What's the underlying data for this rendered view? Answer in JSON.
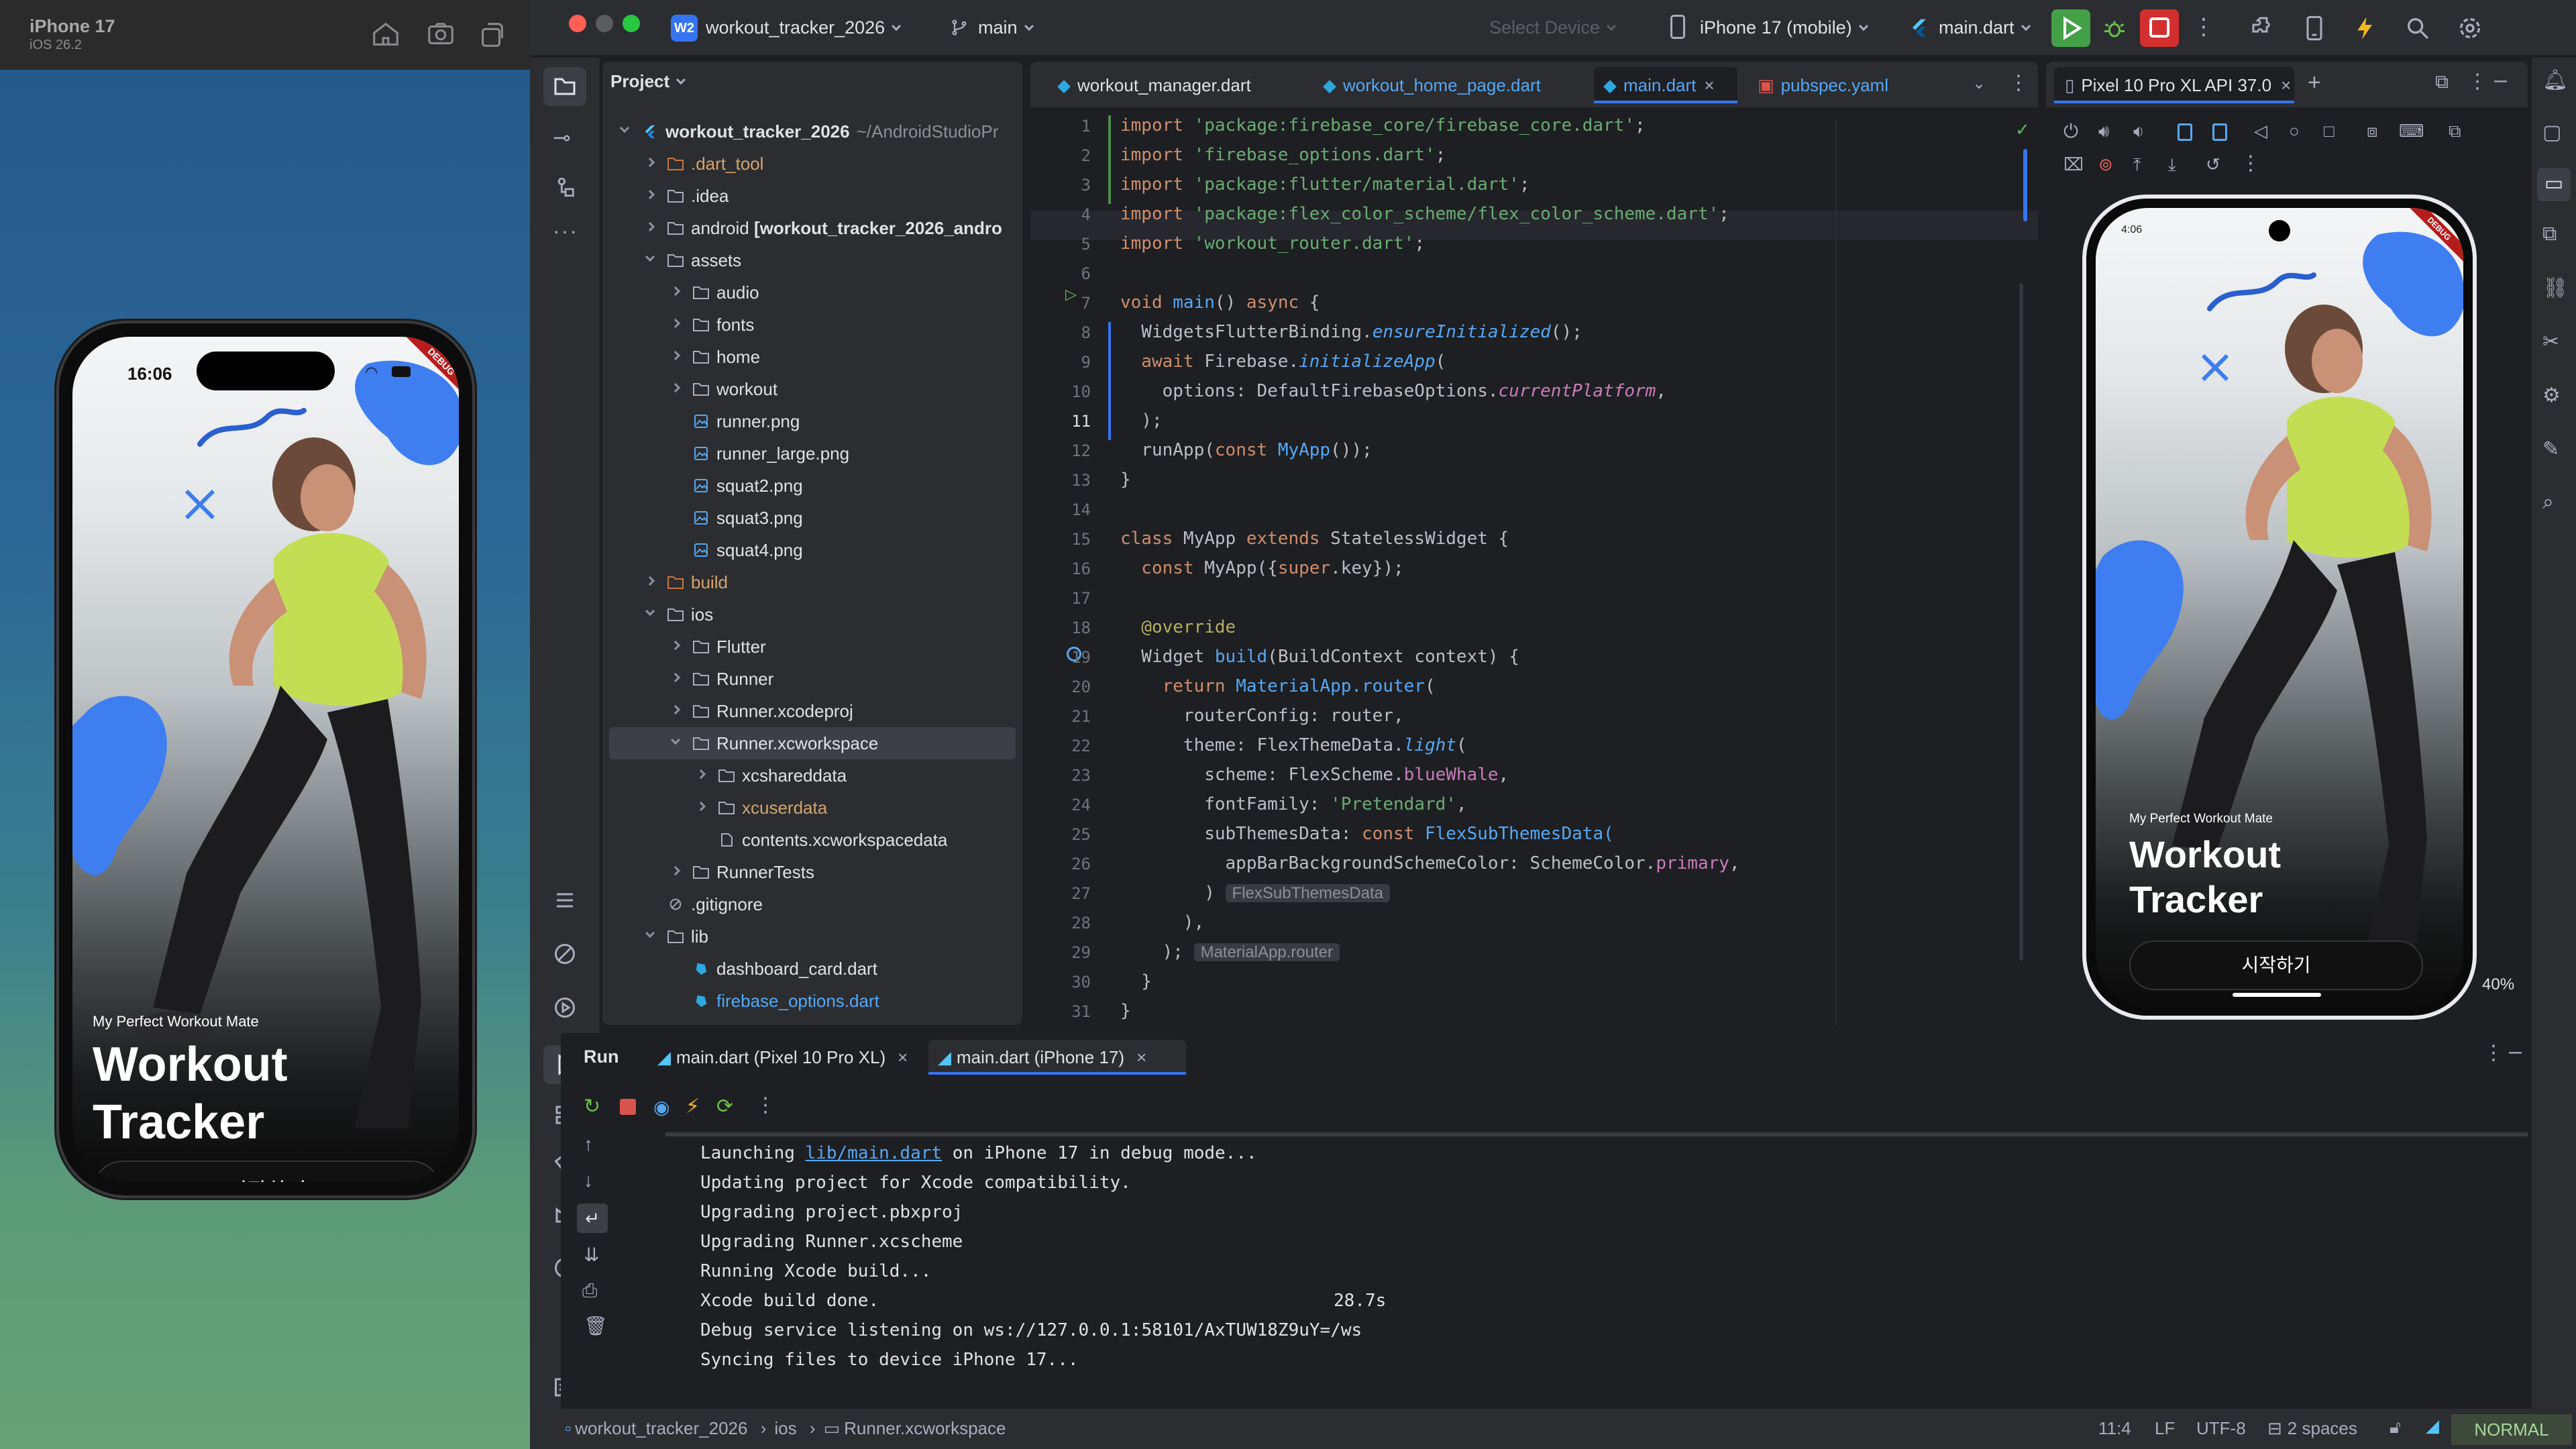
{
  "simulator": {
    "device_name": "iPhone 17",
    "os_version": "iOS 26.2",
    "time": "16:06",
    "app": {
      "subtitle": "My Perfect Workout Mate",
      "title": "Workout Tracker",
      "start_button": "시작하기",
      "debug_badge": "DEBUG"
    }
  },
  "toolbar": {
    "project_badge": "W2",
    "project_name": "workout_tracker_2026",
    "branch": "main",
    "select_device": "Select Device",
    "device": "iPhone 17 (mobile)",
    "run_config": "main.dart"
  },
  "project_panel": {
    "header": "Project",
    "root_name": "workout_tracker_2026",
    "root_path": "~/AndroidStudioPr",
    "items": [
      {
        "label": "workout_tracker_2026",
        "type": "root"
      },
      {
        "label": ".dart_tool",
        "type": "folder-excluded"
      },
      {
        "label": ".idea",
        "type": "folder"
      },
      {
        "label": "android",
        "suffix": "[workout_tracker_2026_andro",
        "type": "folder"
      },
      {
        "label": "assets",
        "type": "folder"
      },
      {
        "label": "audio",
        "type": "folder"
      },
      {
        "label": "fonts",
        "type": "folder"
      },
      {
        "label": "home",
        "type": "folder"
      },
      {
        "label": "workout",
        "type": "folder"
      },
      {
        "label": "runner.png",
        "type": "image"
      },
      {
        "label": "runner_large.png",
        "type": "image"
      },
      {
        "label": "squat2.png",
        "type": "image"
      },
      {
        "label": "squat3.png",
        "type": "image"
      },
      {
        "label": "squat4.png",
        "type": "image"
      },
      {
        "label": "build",
        "type": "folder-excluded"
      },
      {
        "label": "ios",
        "type": "folder"
      },
      {
        "label": "Flutter",
        "type": "folder"
      },
      {
        "label": "Runner",
        "type": "folder"
      },
      {
        "label": "Runner.xcodeproj",
        "type": "folder"
      },
      {
        "label": "Runner.xcworkspace",
        "type": "folder"
      },
      {
        "label": "xcshareddata",
        "type": "folder"
      },
      {
        "label": "xcuserdata",
        "type": "folder"
      },
      {
        "label": "contents.xcworkspacedata",
        "type": "file"
      },
      {
        "label": "RunnerTests",
        "type": "folder"
      },
      {
        "label": ".gitignore",
        "type": "ignore"
      },
      {
        "label": "lib",
        "type": "folder"
      },
      {
        "label": "dashboard_card.dart",
        "type": "dart"
      },
      {
        "label": "firebase_options.dart",
        "type": "dart"
      }
    ]
  },
  "editor": {
    "tabs": [
      {
        "label": "workout_manager.dart"
      },
      {
        "label": "workout_home_page.dart"
      },
      {
        "label": "main.dart"
      },
      {
        "label": "pubspec.yaml"
      }
    ],
    "line_numbers": [
      "1",
      "2",
      "3",
      "4",
      "5",
      "6",
      "7",
      "8",
      "9",
      "10",
      "11",
      "12",
      "13",
      "14",
      "15",
      "16",
      "17",
      "18",
      "19",
      "20",
      "21",
      "22",
      "23",
      "24",
      "25",
      "26",
      "27",
      "28",
      "29",
      "30",
      "31"
    ],
    "code": {
      "l1a": "import ",
      "l1b": "'package:firebase_core/firebase_core.dart'",
      "l1c": ";",
      "l2a": "import ",
      "l2b": "'firebase_options.dart'",
      "l2c": ";",
      "l3a": "import ",
      "l3b": "'package:flutter/material.dart'",
      "l3c": ";",
      "l4a": "import ",
      "l4b": "'package:flex_color_scheme/flex_color_scheme.dart'",
      "l4c": ";",
      "l5a": "import ",
      "l5b": "'workout_router.dart'",
      "l5c": ";",
      "l7a": "void ",
      "l7b": "main",
      "l7c": "() ",
      "l7d": "async ",
      "l7e": "{",
      "l8a": "  WidgetsFlutterBinding.",
      "l8b": "ensureInitialized",
      "l8c": "();",
      "l9a": "  await ",
      "l9b": "Firebase.",
      "l9c": "initializeApp",
      "l9d": "(",
      "l10a": "    options: DefaultFirebaseOptions.",
      "l10b": "currentPlatform",
      "l10c": ",",
      "l11a": "  );",
      "l12a": "  runApp(",
      "l12b": "const ",
      "l12c": "MyApp",
      "l12d": "());",
      "l13a": "}",
      "l15a": "class ",
      "l15b": "MyApp ",
      "l15c": "extends ",
      "l15d": "StatelessWidget {",
      "l16a": "  const ",
      "l16b": "MyApp({",
      "l16c": "super",
      "l16d": ".key});",
      "l18a": "  @override",
      "l19a": "  Widget ",
      "l19b": "build",
      "l19c": "(BuildContext context) {",
      "l20a": "    return ",
      "l20b": "MaterialApp.",
      "l20c": "router",
      "l20d": "(",
      "l21a": "      routerConfig: router,",
      "l22a": "      theme: FlexThemeData.",
      "l22b": "light",
      "l22c": "(",
      "l23a": "        scheme: FlexScheme.",
      "l23b": "blueWhale",
      "l23c": ",",
      "l24a": "        fontFamily: ",
      "l24b": "'Pretendard'",
      "l24c": ",",
      "l25a": "        subThemesData: ",
      "l25b": "const ",
      "l25c": "FlexSubThemesData(",
      "l26a": "          appBarBackgroundSchemeColor: SchemeColor.",
      "l26b": "primary",
      "l26c": ",",
      "l27a": "        )",
      "l27b": "FlexSubThemesData",
      "l28a": "      ),",
      "l29a": "    );",
      "l29b": "MaterialApp.router",
      "l30a": "  }",
      "l31a": "}"
    }
  },
  "device_panel": {
    "tab": "Pixel 10 Pro XL API 37.0",
    "time": "4:06",
    "zoom": "40%"
  },
  "run_panel": {
    "title": "Run",
    "tabs": [
      {
        "label": "main.dart (Pixel 10 Pro XL)"
      },
      {
        "label": "main.dart (iPhone 17)"
      }
    ],
    "console": {
      "l1a": "Launching ",
      "l1b": "lib/main.dart",
      "l1c": " on iPhone 17 in debug mode...",
      "l2": "Updating project for Xcode compatibility.",
      "l3": "Upgrading project.pbxproj",
      "l4": "Upgrading Runner.xcscheme",
      "l5": "Running Xcode build...",
      "l6a": "Xcode build done.",
      "l6b": "28.7s",
      "l7": "Debug service listening on ws://127.0.0.1:58101/AxTUW18Z9uY=/ws",
      "l8": "Syncing files to device iPhone 17..."
    }
  },
  "status_bar": {
    "crumbs": [
      "workout_tracker_2026",
      "ios",
      "Runner.xcworkspace"
    ],
    "position": "11:4",
    "line_sep": "LF",
    "encoding": "UTF-8",
    "indent": "2 spaces",
    "mode": "NORMAL"
  },
  "colors": {
    "accent": "#3574f0",
    "run_green": "#43a047",
    "stop_red": "#d32f2f",
    "debug_red": "#b71c1c",
    "blob_blue": "#3e7ef0",
    "shirt_lime": "#c4de54"
  }
}
